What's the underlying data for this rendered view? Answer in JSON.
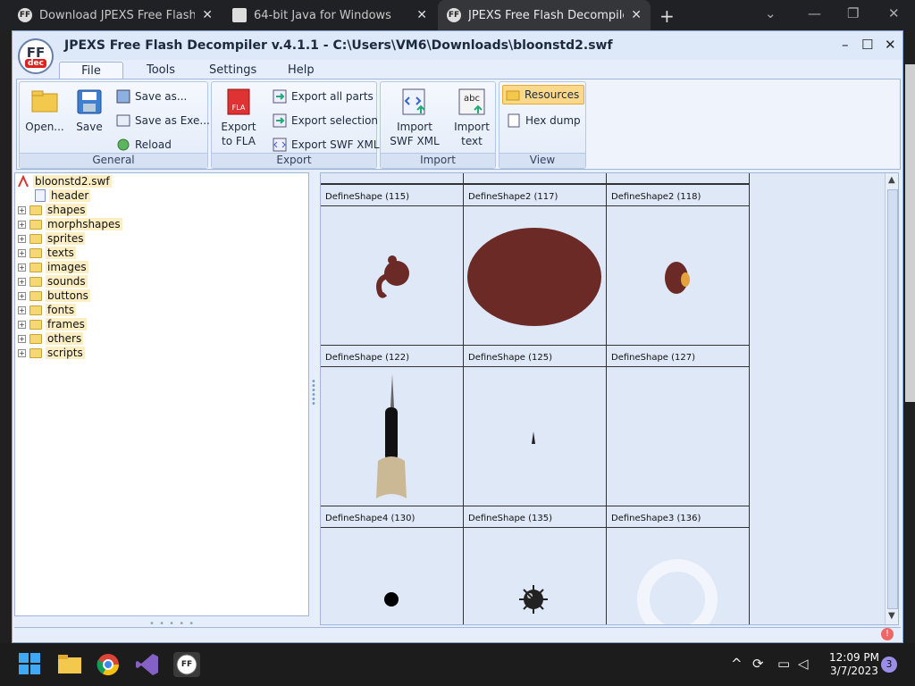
{
  "browser": {
    "tabs": [
      {
        "label": "Download JPEXS Free Flash Deco",
        "favicon": "ffdec-icon"
      },
      {
        "label": "64-bit Java for Windows",
        "favicon": "java-page-icon"
      },
      {
        "label": "JPEXS Free Flash Decompiler - De",
        "favicon": "ffdec-icon"
      }
    ],
    "new_tab": "+"
  },
  "window": {
    "logo_text": "FF",
    "logo_sub": "dec",
    "title": "JPEXS Free Flash Decompiler v.4.1.1 - C:\\Users\\VM6\\Downloads\\bloonstd2.swf"
  },
  "menu": {
    "items": [
      "File",
      "Tools",
      "Settings",
      "Help"
    ],
    "active": "File"
  },
  "ribbon": {
    "general": {
      "label": "General",
      "open": "Open...",
      "save": "Save",
      "save_as": "Save as...",
      "save_as_exe": "Save as Exe...",
      "reload": "Reload"
    },
    "export": {
      "label": "Export",
      "export_fla_1": "Export",
      "export_fla_2": "to FLA",
      "export_all": "Export all parts",
      "export_selection": "Export selection",
      "export_swf_xml": "Export SWF XML"
    },
    "import": {
      "label": "Import",
      "import_swf_xml_1": "Import",
      "import_swf_xml_2": "SWF XML",
      "import_text_1": "Import",
      "import_text_2": "text"
    },
    "view": {
      "label": "View",
      "resources": "Resources",
      "hex_dump": "Hex dump"
    }
  },
  "tree": {
    "root": "bloonstd2.swf",
    "items": [
      "header",
      "shapes",
      "morphshapes",
      "sprites",
      "texts",
      "images",
      "sounds",
      "buttons",
      "fonts",
      "frames",
      "others",
      "scripts"
    ]
  },
  "preview": {
    "rows": [
      [
        "DefineShape (115)",
        "DefineShape2 (117)",
        "DefineShape2 (118)"
      ],
      [
        "DefineShape (122)",
        "DefineShape (125)",
        "DefineShape (127)"
      ],
      [
        "DefineShape4 (130)",
        "DefineShape (135)",
        "DefineShape3 (136)"
      ]
    ]
  },
  "taskbar": {
    "time": "12:09 PM",
    "date": "3/7/2023",
    "notifications": "3"
  }
}
